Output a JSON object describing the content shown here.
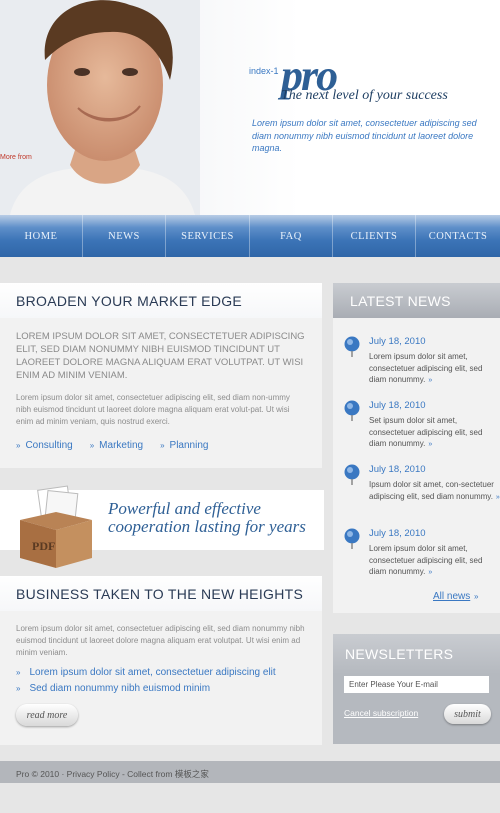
{
  "header": {
    "more_info": "More from",
    "index_label": "index-1",
    "logo": "pro",
    "tagline": "The next level of your success",
    "text": "Lorem ipsum dolor sit amet, consectetuer adipiscing sed diam nonummy nibh euismod tincidunt ut laoreet dolore magna."
  },
  "nav": {
    "items": [
      {
        "label": "HOME"
      },
      {
        "label": "NEWS"
      },
      {
        "label": "SERVICES"
      },
      {
        "label": "FAQ"
      },
      {
        "label": "CLIENTS"
      },
      {
        "label": "CONTACTS"
      }
    ]
  },
  "section1": {
    "title": "BROADEN YOUR MARKET EDGE",
    "lead": "LOREM IPSUM DOLOR SIT AMET, CONSECTETUER ADIPISCING ELIT, SED DIAM NONUMMY NIBH EUISMOD TINCIDUNT UT LAOREET DOLORE MAGNA ALIQUAM ERAT VOLUTPAT. UT WISI ENIM AD MINIM VENIAM.",
    "text": "Lorem ipsum dolor sit amet, consectetuer adipiscing elit, sed diam non-ummy nibh euismod tincidunt ut laoreet dolore magna aliquam erat volut-pat. Ut wisi enim ad minim veniam, quis nostrud exerci.",
    "links": [
      "Consulting",
      "Marketing",
      "Planning"
    ],
    "arrow": "»"
  },
  "promo": {
    "line1": "Powerful and effective",
    "line2": "cooperation lasting for years",
    "box_label": "PDF"
  },
  "section2": {
    "title": "BUSINESS TAKEN TO THE NEW HEIGHTS",
    "text": "Lorem ipsum dolor sit amet, consectetuer adipiscing elit, sed diam nonummy nibh euismod tincidunt ut laoreet dolore magna aliquam erat volutpat. Ut wisi enim ad minim veniam.",
    "list": [
      "Lorem ipsum dolor sit amet, consectetuer adipiscing elit",
      "Sed diam nonummy nibh euismod minim"
    ],
    "read_more": "read more"
  },
  "news": {
    "title": "LATEST NEWS",
    "items": [
      {
        "date": "July 18, 2010",
        "text": "Lorem ipsum dolor sit amet, consectetuer adipiscing elit, sed diam nonummy."
      },
      {
        "date": "July 18, 2010",
        "text": "Set ipsum dolor sit amet, consectetuer adipiscing elit, sed diam nonummy."
      },
      {
        "date": "July 18, 2010",
        "text": "Ipsum dolor sit amet, con-sectetuer adipiscing elit, sed diam nonummy."
      },
      {
        "date": "July 18, 2010",
        "text": "Lorem ipsum dolor sit amet, consectetuer adipiscing elit, sed diam nonummy."
      }
    ],
    "more_glyph": "»",
    "all_news": "All news",
    "all_news_arrow": "»"
  },
  "newsletter": {
    "title": "NEWSLETTERS",
    "email_placeholder": "Enter Please Your E-mail",
    "cancel": "Cancel subscription",
    "submit": "submit"
  },
  "footer": {
    "text": "Pro © 2010 · Privacy Policy - Collect from 模板之家"
  },
  "colors": {
    "accent": "#3a78c2",
    "nav": "#3c74b7",
    "heading": "#2a3b55",
    "sidebar_header": "#a9adb4"
  }
}
